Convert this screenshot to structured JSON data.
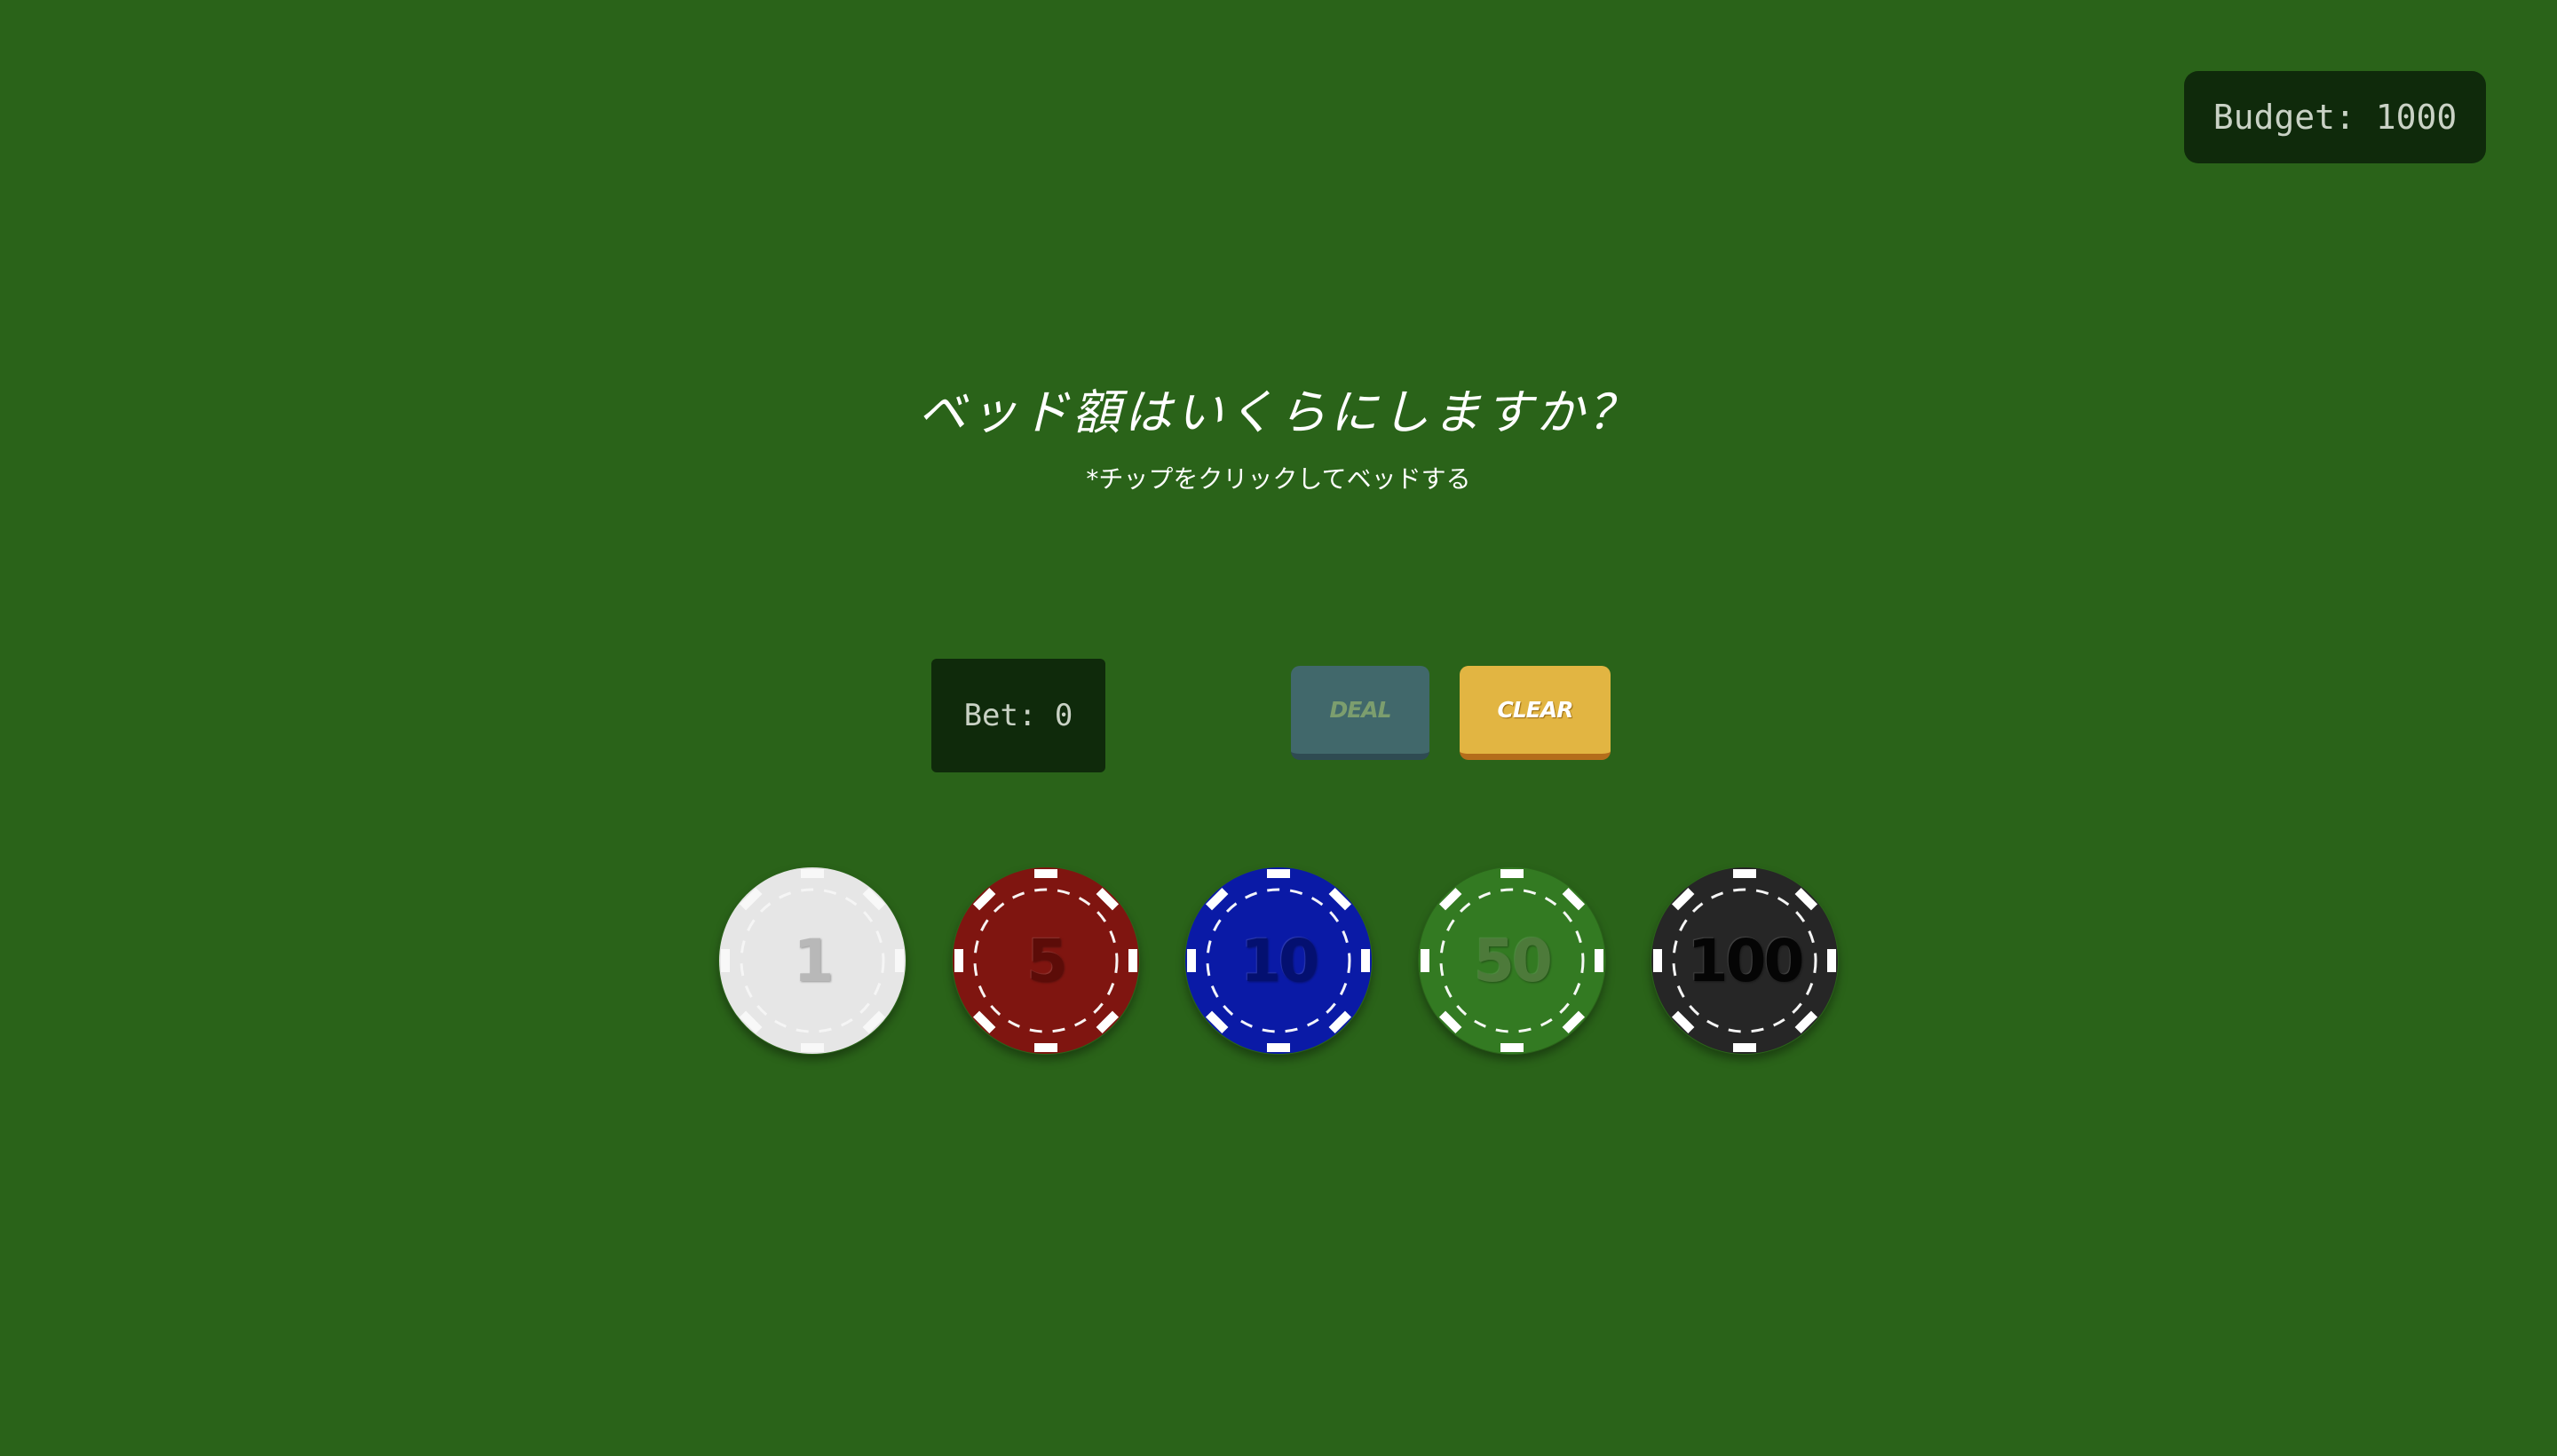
{
  "budget": {
    "text": "Budget: 1000"
  },
  "prompt": {
    "title": "ベッド額はいくらにしますか？",
    "subtitle": "*チップをクリックしてベッドする"
  },
  "bet": {
    "text": "Bet: 0"
  },
  "buttons": {
    "deal_label": "DEAL",
    "clear_label": "CLEAR"
  },
  "chips": [
    {
      "value": "1",
      "color": "#e6e6e6",
      "edge": "#ffffff",
      "text_color": "#b8b8b8"
    },
    {
      "value": "5",
      "color": "#7f1510",
      "edge": "#ffffff",
      "text_color": "#5c0c08"
    },
    {
      "value": "10",
      "color": "#0a1aa6",
      "edge": "#ffffff",
      "text_color": "#041070"
    },
    {
      "value": "50",
      "color": "#337a22",
      "edge": "#ffffff",
      "text_color": "#4d7a3a"
    },
    {
      "value": "100",
      "color": "#262626",
      "edge": "#ffffff",
      "text_color": "#050505"
    }
  ],
  "colors": {
    "table": "#2a6319",
    "panel": "#0f2a0b",
    "deal": "#41686b",
    "clear": "#e2b542"
  }
}
